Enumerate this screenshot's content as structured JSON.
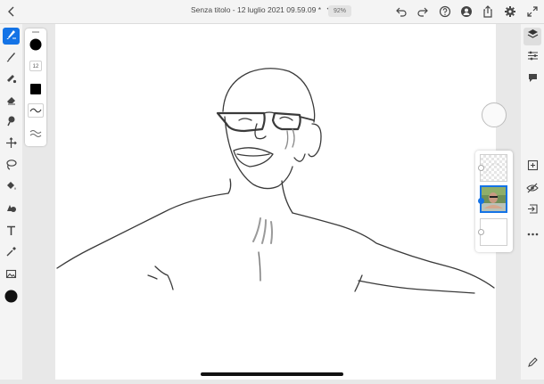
{
  "document": {
    "title": "Senza titolo - 12 luglio 2021 09.59.09 *",
    "zoom": "92%"
  },
  "topbar": {
    "icons": [
      "back-icon",
      "chevron-down-icon",
      "undo-icon",
      "redo-icon",
      "help-icon",
      "user-icon",
      "share-icon",
      "gear-icon",
      "fullscreen-icon"
    ]
  },
  "left_toolbar": {
    "tools": [
      "pixel-brush",
      "vector-brush",
      "mixer-brush",
      "eraser",
      "smudge",
      "transform",
      "lasso",
      "fill",
      "shape",
      "text",
      "eyedropper",
      "image"
    ],
    "active_tool": "pixel-brush",
    "current_color": "#111111"
  },
  "props_panel": {
    "brush_size": "12",
    "opacity_swatch": "#000000"
  },
  "right_bar": {
    "icons": [
      "layers-icon",
      "sliders-icon",
      "comment-icon",
      "add-layer-icon",
      "hide-layer-icon",
      "import-icon",
      "more-icon",
      "pencil-icon"
    ]
  },
  "layers": {
    "count": 3,
    "selected_index": 1
  },
  "colors": {
    "accent": "#1473e6",
    "canvas": "#ffffff",
    "chrome": "#f4f4f4"
  }
}
